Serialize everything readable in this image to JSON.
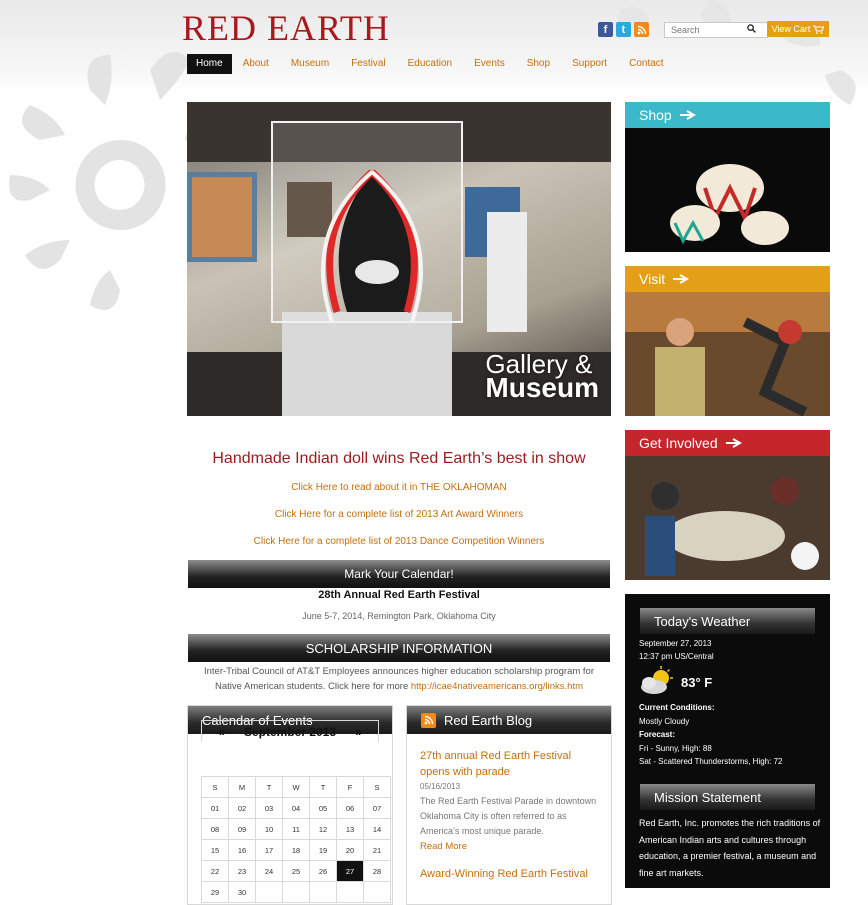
{
  "brand": {
    "logo_text": "RED EARTH"
  },
  "header": {
    "search_placeholder": "Search",
    "cart_label": "View Cart"
  },
  "nav": {
    "items": [
      "Home",
      "About",
      "Museum",
      "Festival",
      "Education",
      "Events",
      "Shop",
      "Support",
      "Contact"
    ],
    "active": "Home"
  },
  "hero": {
    "line1": "Gallery &",
    "line2": "Museum"
  },
  "side": {
    "shop": {
      "label": "Shop",
      "color": "#3bb8c9"
    },
    "visit": {
      "label": "Visit",
      "color": "#e3a017"
    },
    "involved": {
      "label": "Get Involved",
      "color": "#c4262b"
    }
  },
  "news": {
    "headline": "Handmade Indian doll wins Red Earth’s best in show",
    "links": [
      "Click Here to read about it in THE OKLAHOMAN",
      "Click Here for a complete list of 2013 Art Award Winners",
      "Click Here for a complete list of 2013 Dance Competition Winners"
    ]
  },
  "calendar_bar": {
    "title": "Mark Your Calendar!",
    "event_title": "28th Annual Red Earth Festival",
    "event_date": "June 5-7, 2014, Remington Park, Oklahoma City"
  },
  "scholarship": {
    "title": "SCHOLARSHIP INFORMATION",
    "text": "Inter-Tribal Council of AT&T Employees announces higher education scholarship program for Native American students.  Click here for more",
    "link": "http://icae4nativeamericans.org/links.htm"
  },
  "events_calendar": {
    "title": "Calendar of Events",
    "month": "September 2013",
    "prev": "«",
    "next": "»",
    "weekdays": [
      "S",
      "M",
      "T",
      "W",
      "T",
      "F",
      "S"
    ],
    "weeks": [
      [
        "01",
        "02",
        "03",
        "04",
        "05",
        "06",
        "07"
      ],
      [
        "08",
        "09",
        "10",
        "11",
        "12",
        "13",
        "14"
      ],
      [
        "15",
        "16",
        "17",
        "18",
        "19",
        "20",
        "21"
      ],
      [
        "22",
        "23",
        "24",
        "25",
        "26",
        "27",
        "28"
      ],
      [
        "29",
        "30",
        "",
        "",
        "",
        "",
        ""
      ]
    ],
    "today": "27"
  },
  "blog": {
    "title": "Red Earth Blog",
    "posts": [
      {
        "title": "27th annual Red Earth Festival opens with parade",
        "date": "05/16/2013",
        "excerpt": "The Red Earth Festival Parade in downtown Oklahoma City is often referred to as America’s most unique parade.",
        "read_more": "Read More"
      },
      {
        "title": "Award-Winning Red Earth Festival"
      }
    ]
  },
  "weather": {
    "title": "Today's Weather",
    "date": "September 27, 2013",
    "time": "12:37 pm US/Central",
    "temp": "83° F",
    "conditions_label": "Current Conditions:",
    "conditions": "Mostly Cloudy",
    "forecast_label": "Forecast:",
    "forecast": [
      "Fri - Sunny, High: 88",
      "Sat - Scattered Thunderstorms, High: 72"
    ]
  },
  "mission": {
    "title": "Mission Statement",
    "text": "Red Earth, Inc. promotes the rich traditions of American Indian arts and cultures through education, a premier festival, a museum and fine art markets."
  }
}
